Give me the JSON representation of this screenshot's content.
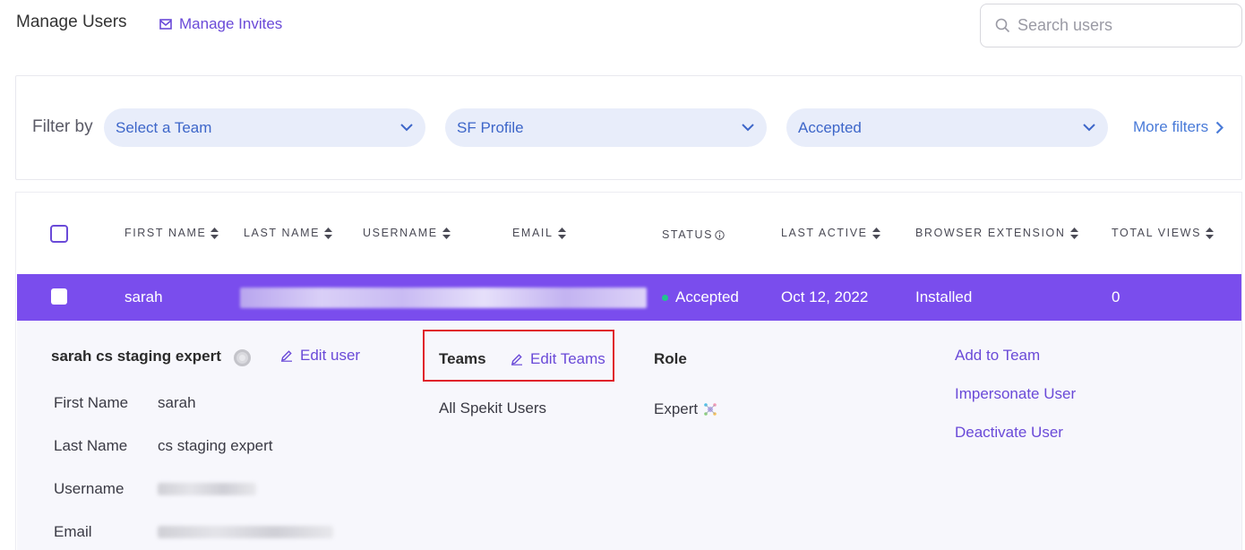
{
  "header": {
    "title": "Manage Users",
    "invites_label": "Manage Invites",
    "search_placeholder": "Search users"
  },
  "filters": {
    "label": "Filter by",
    "team": "Select a Team",
    "profile": "SF Profile",
    "status": "Accepted",
    "more": "More filters"
  },
  "table": {
    "columns": [
      "FIRST NAME",
      "LAST NAME",
      "USERNAME",
      "EMAIL",
      "STATUS",
      "LAST ACTIVE",
      "BROWSER EXTENSION",
      "TOTAL VIEWS"
    ],
    "row": {
      "first_name": "sarah",
      "status": "Accepted",
      "last_active": "Oct 12, 2022",
      "browser_extension": "Installed",
      "total_views": "0"
    }
  },
  "detail": {
    "full_name": "sarah cs staging expert",
    "edit_user": "Edit user",
    "fields": {
      "first_name_label": "First Name",
      "first_name_value": "sarah",
      "last_name_label": "Last Name",
      "last_name_value": "cs staging expert",
      "username_label": "Username",
      "email_label": "Email"
    },
    "teams_label": "Teams",
    "edit_teams": "Edit Teams",
    "team_value": "All Spekit Users",
    "role_label": "Role",
    "role_value": "Expert",
    "actions": {
      "add_to_team": "Add to Team",
      "impersonate": "Impersonate User",
      "deactivate": "Deactivate User"
    }
  },
  "colors": {
    "accent": "#7a4ded",
    "link": "#6a4ad8",
    "filter_bg": "#e8edfa",
    "status_dot": "#22c38e",
    "highlight": "#e0202a"
  }
}
